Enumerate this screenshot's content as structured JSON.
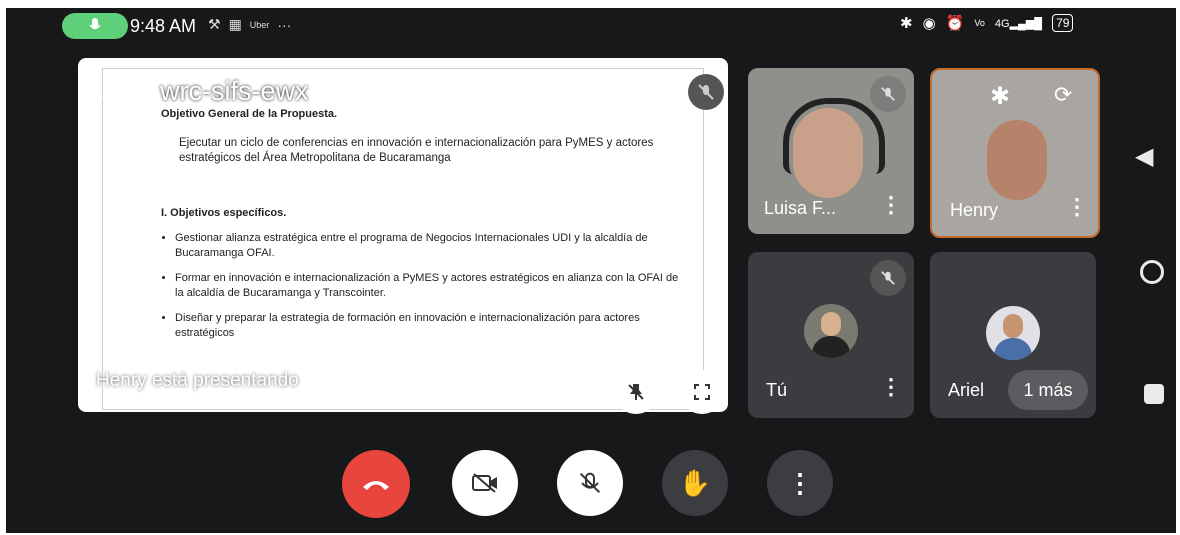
{
  "status_bar": {
    "time": "9:48 AM",
    "app_label": "Uber",
    "more": "···",
    "battery": "79",
    "net": "4G"
  },
  "meeting": {
    "title": "wrc-sifs-ewx",
    "presenting": "Henry está presentando"
  },
  "slide": {
    "heading": "Objetivo General de la Propuesta.",
    "general": "Ejecutar un ciclo de conferencias en innovación e internacionalización para PyMES y actores estratégicos del Área Metropolitana de Bucaramanga",
    "sub_heading": "I.   Objetivos específicos.",
    "bullets": [
      "Gestionar alianza estratégica entre el programa de Negocios Internacionales UDI y la alcaldía de Bucaramanga OFAI.",
      "Formar en innovación e internacionalización a PyMES y actores estratégicos en alianza con la OFAI de la alcaldía de Bucaramanga y Transcointer.",
      "Diseñar y preparar la estrategia de formación en innovación e internacionalización para actores estratégicos"
    ]
  },
  "participants": {
    "luisa": "Luisa F...",
    "henry": "Henry",
    "you": "Tú",
    "ariel": "Ariel",
    "more": "1 más"
  },
  "colors": {
    "end_call": "#e8453c",
    "ctrl_dark": "#3c3d40",
    "mic_pill": "#5fd07a"
  }
}
